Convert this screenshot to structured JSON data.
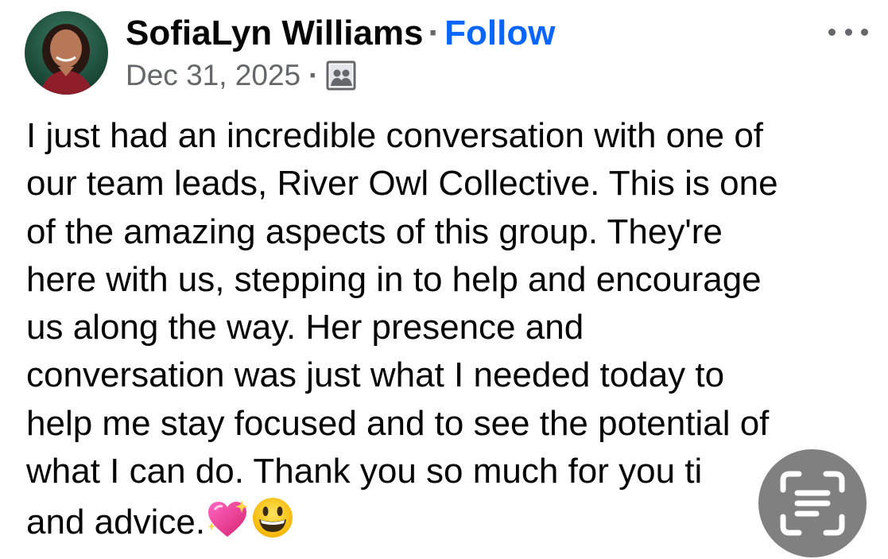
{
  "post": {
    "author_name": "SofiaLyn Williams",
    "separator": "·",
    "follow_label": "Follow",
    "date": "Dec 31, 2025",
    "audience_icon": "group-audience-icon",
    "more_icon": "more-options-icon",
    "body_lines": [
      "I just had an incredible conversation with one of",
      "our team leads, River Owl Collective. This is one",
      "of the amazing aspects of this group. They're",
      "here with us, stepping in to help and encourage",
      "us along the way. Her presence and",
      "conversation was just what I needed today to",
      "help me stay focused and to see the potential of",
      "what I can do. Thank you so much for you ti",
      "and advice."
    ],
    "emojis": [
      "sparkling-heart-icon",
      "grinning-face-icon"
    ]
  },
  "overlay": {
    "scan_icon": "live-text-scan-icon"
  },
  "colors": {
    "text": "#050505",
    "secondary": "#65676b",
    "link": "#0866ff",
    "overlay": "#6e6e6e"
  }
}
